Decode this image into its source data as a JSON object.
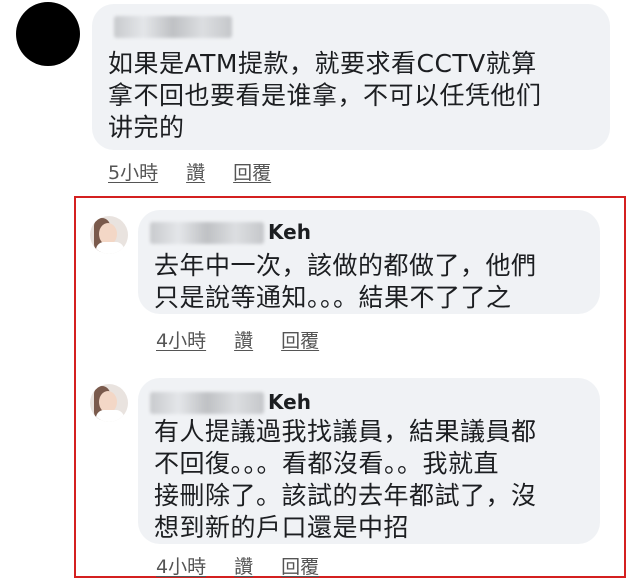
{
  "top_comment": {
    "text": "如果是ATM提款，就要求看CCTV就算\n拿不回也要看是谁拿，不可以任凭他们\n讲完的",
    "time": "5小時",
    "like": "讚",
    "reply": "回覆"
  },
  "replies": [
    {
      "author_suffix": "Keh",
      "text": "去年中一次，該做的都做了，他們\n只是說等通知。。。結果不了了之",
      "time": "4小時",
      "like": "讚",
      "reply": "回覆"
    },
    {
      "author_suffix": "Keh",
      "text": "有人提議過我找議員，結果議員都\n不回復。。。看都沒看。。我就直\n接刪除了。該試的去年都試了，沒\n想到新的戶口還是中招",
      "time": "4小時",
      "like": "讚",
      "reply": "回覆"
    }
  ],
  "colors": {
    "bubble": "#f0f2f5",
    "highlight_border": "#d42020"
  },
  "icons": {
    "top_avatar": "avatar-icon",
    "reply_avatar": "avatar-icon"
  }
}
